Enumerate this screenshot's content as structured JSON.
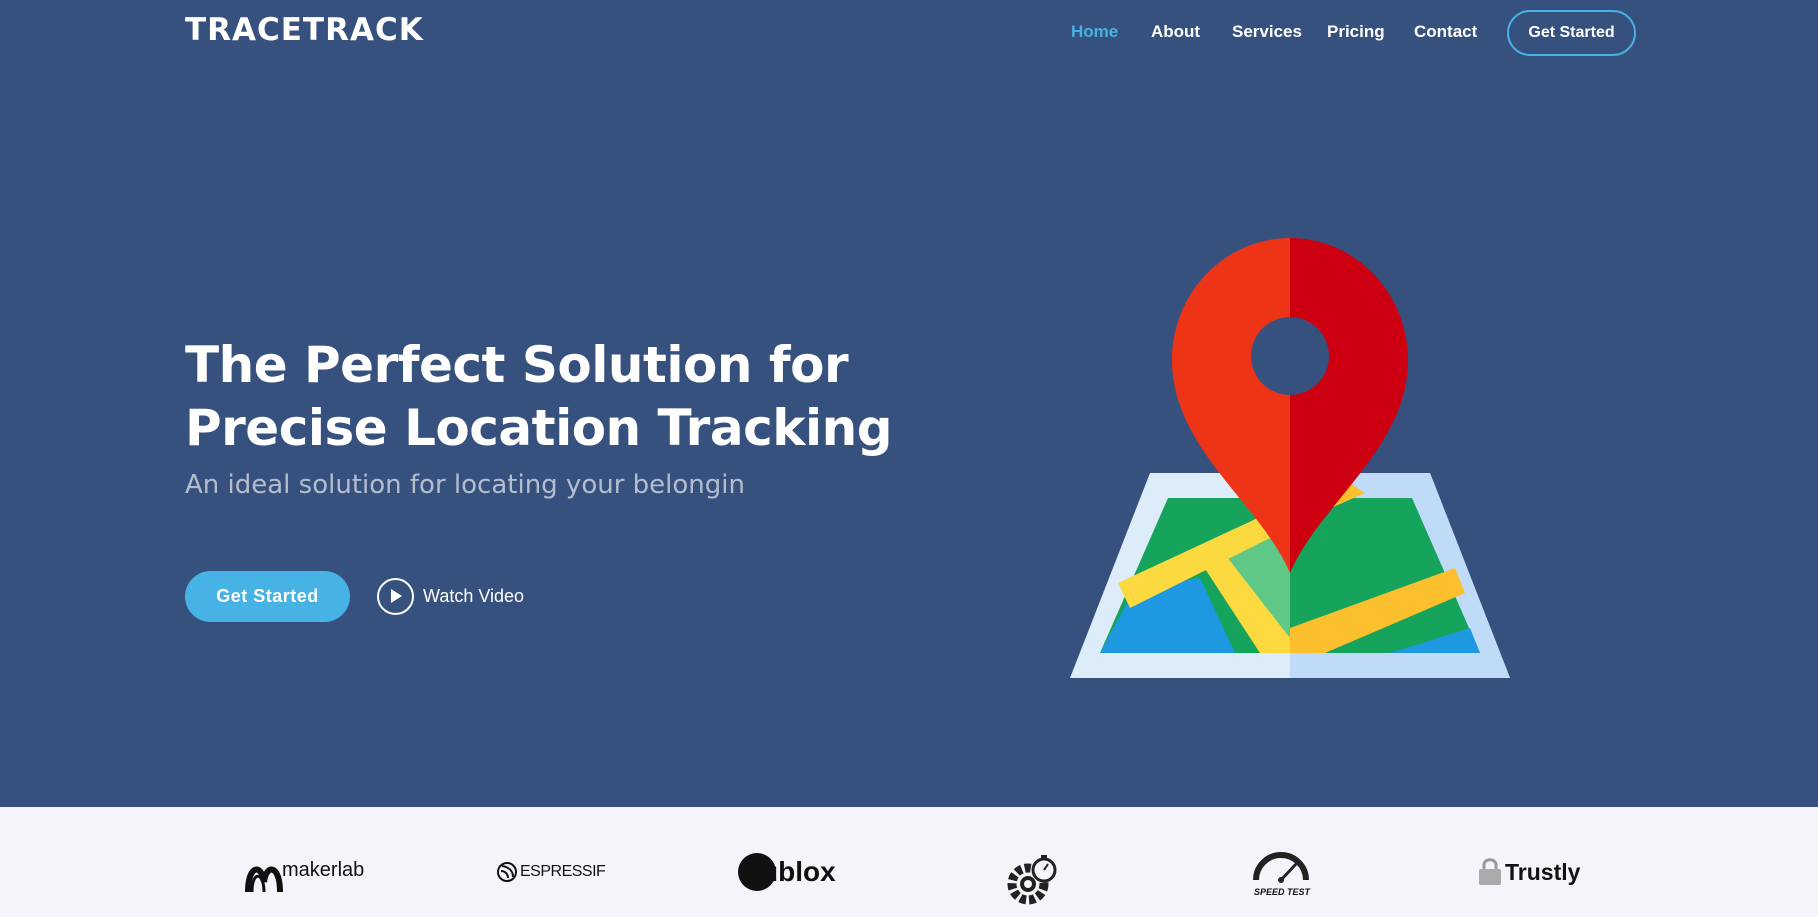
{
  "brand": {
    "name": "TRACETRACK"
  },
  "nav": {
    "items": [
      {
        "label": "Home",
        "active": true
      },
      {
        "label": "About",
        "active": false
      },
      {
        "label": "Services",
        "active": false
      },
      {
        "label": "Pricing",
        "active": false
      },
      {
        "label": "Contact",
        "active": false
      }
    ],
    "cta_label": "Get Started"
  },
  "hero": {
    "title_line1": "The Perfect Solution for",
    "title_line2": "Precise Location Tracking",
    "subtitle": "An ideal solution for locating your belongin",
    "primary_button": "Get Started",
    "secondary_button": "Watch Video",
    "illustration": "map-pin-icon"
  },
  "clients": {
    "logos": [
      {
        "name": "makerlab",
        "icon": "makerlab-logo"
      },
      {
        "name": "ESPRESSIF",
        "icon": "espressif-logo"
      },
      {
        "name": "ublox",
        "icon": "ublox-logo"
      },
      {
        "name": "",
        "icon": "gear-stopwatch-logo"
      },
      {
        "name": "SPEED TEST",
        "icon": "speedtest-logo"
      },
      {
        "name": "Trustly",
        "icon": "trustly-logo"
      }
    ]
  },
  "colors": {
    "hero_bg": "#37517e",
    "accent": "#47b2e4",
    "clients_bg": "#f3f5fa"
  }
}
